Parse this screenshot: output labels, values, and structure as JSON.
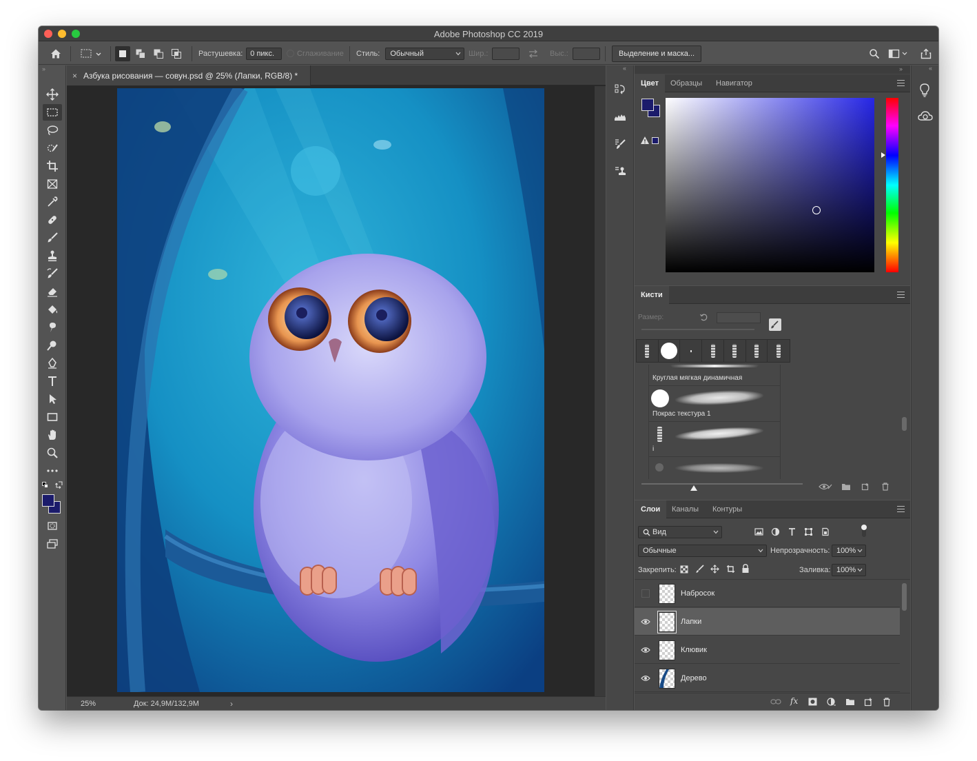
{
  "window": {
    "title": "Adobe Photoshop CC 2019"
  },
  "options_bar": {
    "feather_label": "Растушевка:",
    "feather_value": "0 пикс.",
    "antialias_label": "Сглаживание",
    "style_label": "Стиль:",
    "style_value": "Обычный",
    "width_label": "Шир.:",
    "height_label": "Выс.:",
    "select_mask_button": "Выделение и маска..."
  },
  "document": {
    "tab_title": "Азбука рисования — совун.psd @ 25% (Лапки, RGB/8) *",
    "zoom": "25%",
    "doc_info": "Док: 24,9M/132,9M"
  },
  "color_panel": {
    "tabs": [
      "Цвет",
      "Образцы",
      "Навигатор"
    ],
    "foreground_color": "#1b1b6b",
    "background_color": "#1b1b6b"
  },
  "brushes_panel": {
    "tab": "Кисти",
    "size_label": "Размер:",
    "presets": [
      {
        "name": "Круглая мягкая динамичная"
      },
      {
        "name": "Покрас текстура 1"
      },
      {
        "name": "i"
      },
      {
        "name": ""
      }
    ]
  },
  "layers_panel": {
    "tabs": [
      "Слои",
      "Каналы",
      "Контуры"
    ],
    "filter_label": "Вид",
    "blend_mode": "Обычные",
    "opacity_label": "Непрозрачность:",
    "opacity_value": "100%",
    "lock_label": "Закрепить:",
    "fill_label": "Заливка:",
    "fill_value": "100%",
    "layers": [
      {
        "name": "Набросок",
        "visible": false,
        "selected": false
      },
      {
        "name": "Лапки",
        "visible": true,
        "selected": true
      },
      {
        "name": "Клювик",
        "visible": true,
        "selected": false
      },
      {
        "name": "Дерево",
        "visible": true,
        "selected": false
      }
    ]
  },
  "tools": [
    "move-tool",
    "marquee-tool",
    "lasso-tool",
    "quick-select-tool",
    "crop-tool",
    "frame-tool",
    "eyedropper-tool",
    "healing-tool",
    "brush-tool",
    "stamp-tool",
    "history-brush-tool",
    "eraser-tool",
    "paint-bucket-tool",
    "smudge-tool",
    "dodge-tool",
    "pen-tool",
    "type-tool",
    "path-select-tool",
    "rectangle-tool",
    "hand-tool",
    "zoom-tool",
    "more-tools"
  ]
}
